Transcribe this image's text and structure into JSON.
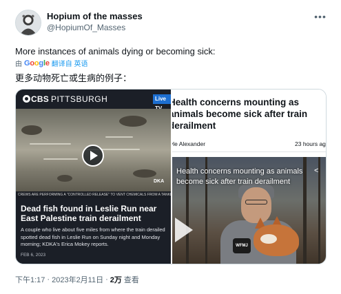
{
  "author": {
    "name": "Hopium of the masses",
    "handle": "@HopiumOf_Masses"
  },
  "more_icon": "more-horizontal-icon",
  "tweet": {
    "text": "More instances of animals dying or becoming sick:",
    "translate_prefix": "由",
    "translate_provider": "Google",
    "translate_link": "翻译自 英语",
    "translated_text": "更多动物死亡或生病的例子："
  },
  "media": {
    "left_card": {
      "brand": "CBS",
      "city": "PITTSBURGH",
      "live_tag": "Live TV",
      "ticker": "CREWS ARE PERFORMING A \"CONTROLLED RELEASE\" TO VENT CHEMICALS FROM A TANKER CAR",
      "badge": "DKA",
      "headline": "Dead fish found in Leslie Run near East Palestine train derailment",
      "description": "A couple who live about five miles from where the train derailed spotted dead fish in Leslie Run on Sunday night and Monday morning; KDKA's Erica Mokey reports.",
      "date": "FEB 6, 2023"
    },
    "right_card": {
      "headline": "Health concerns mounting as animals become sick after train derailment",
      "byline": "yle Alexander",
      "time": "23 hours ag",
      "video_caption": "Health concerns mounting as animals become sick after train derailment",
      "mic_label": "WFMJ"
    }
  },
  "footer": {
    "time": "下午1:17",
    "separator1": "·",
    "date": "2023年2月11日",
    "separator2": "·",
    "views_count": "2万",
    "views_label": "查看"
  }
}
